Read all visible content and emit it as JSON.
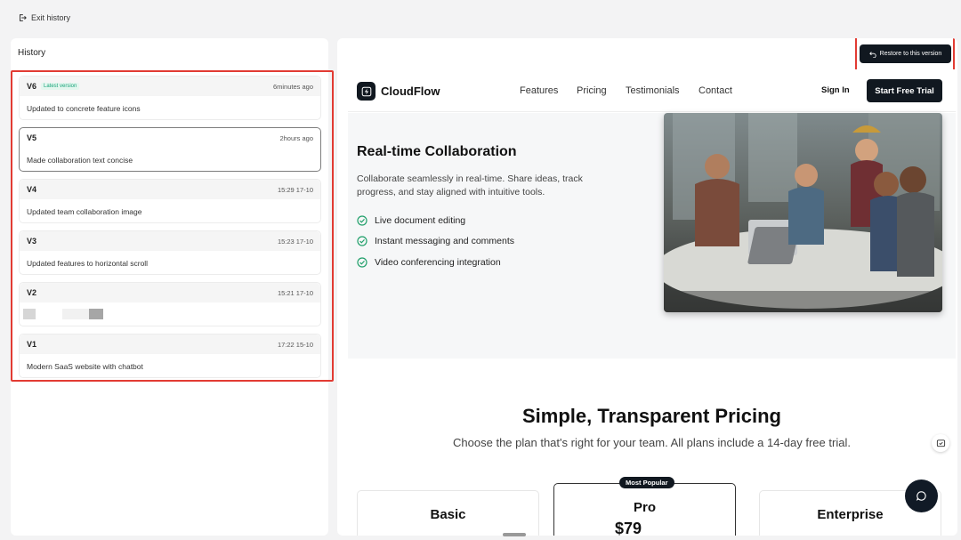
{
  "topbar": {
    "exit_label": "Exit history"
  },
  "history": {
    "title": "History",
    "versions": [
      {
        "label": "V6",
        "badge": "Latest version",
        "time": "6minutes ago",
        "description": "Updated to concrete feature icons"
      },
      {
        "label": "V5",
        "badge": "",
        "time": "2hours ago",
        "description": "Made collaboration text concise"
      },
      {
        "label": "V4",
        "badge": "",
        "time": "15:29 17-10",
        "description": "Updated team collaboration image"
      },
      {
        "label": "V3",
        "badge": "",
        "time": "15:23 17-10",
        "description": "Updated features to horizontal scroll"
      },
      {
        "label": "V2",
        "badge": "",
        "time": "15:21 17-10",
        "description": ""
      },
      {
        "label": "V1",
        "badge": "",
        "time": "17:22 15-10",
        "description": "Modern SaaS website with chatbot"
      }
    ],
    "selected_version": "V5"
  },
  "preview": {
    "restore_label": "Restore to this version",
    "site": {
      "brand": "CloudFlow",
      "nav_links": [
        "Features",
        "Pricing",
        "Testimonials",
        "Contact"
      ],
      "signin_label": "Sign In",
      "cta_label": "Start Free Trial",
      "feature": {
        "title": "Real-time Collaboration",
        "description": "Collaborate seamlessly in real-time. Share ideas, track progress, and stay aligned with intuitive tools.",
        "items": [
          "Live document editing",
          "Instant messaging and comments",
          "Video conferencing integration"
        ]
      },
      "pricing": {
        "title": "Simple, Transparent Pricing",
        "subtitle": "Choose the plan that's right for your team. All plans include a 14-day free trial.",
        "plans": [
          {
            "name": "Basic",
            "badge": "",
            "price": ""
          },
          {
            "name": "Pro",
            "badge": "Most Popular",
            "price": "$79"
          },
          {
            "name": "Enterprise",
            "badge": "",
            "price": ""
          }
        ]
      }
    }
  },
  "colors": {
    "accent_dark": "#111820",
    "highlight": "#e23b33",
    "check_green": "#22a06b",
    "badge_green": "#1aa37a"
  },
  "icons": [
    "exit-icon",
    "undo-icon",
    "bolt-icon",
    "check-circle-icon",
    "feedback-icon",
    "chat-icon"
  ]
}
